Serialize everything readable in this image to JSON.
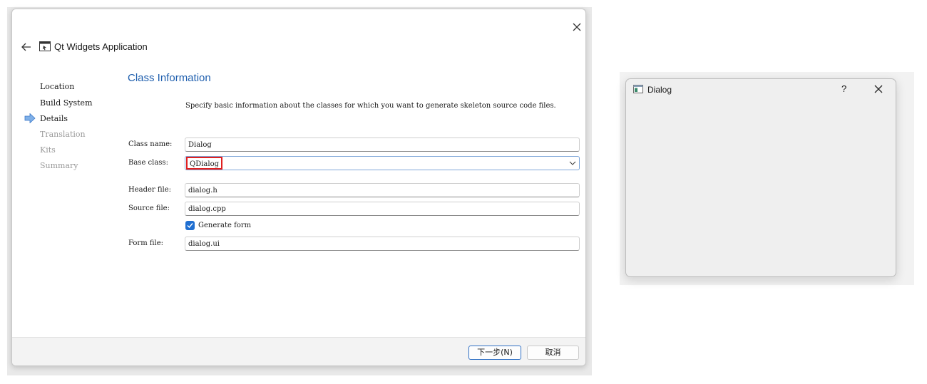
{
  "wizard": {
    "title": "Qt Widgets Application",
    "steps": [
      {
        "label": "Location",
        "state": "done"
      },
      {
        "label": "Build System",
        "state": "done"
      },
      {
        "label": "Details",
        "state": "current"
      },
      {
        "label": "Translation",
        "state": "pending"
      },
      {
        "label": "Kits",
        "state": "pending"
      },
      {
        "label": "Summary",
        "state": "pending"
      }
    ],
    "section_title": "Class Information",
    "description": "Specify basic information about the classes for which you want to generate skeleton source code files.",
    "fields": {
      "class_name": {
        "label": "Class name:",
        "value": "Dialog"
      },
      "base_class": {
        "label": "Base class:",
        "value": "QDialog"
      },
      "header_file": {
        "label": "Header file:",
        "value": "dialog.h"
      },
      "source_file": {
        "label": "Source file:",
        "value": "dialog.cpp"
      },
      "generate_form": {
        "label": "Generate form",
        "checked": true
      },
      "form_file": {
        "label": "Form file:",
        "value": "dialog.ui"
      }
    },
    "buttons": {
      "next": "下一步(N)",
      "cancel": "取消"
    },
    "icons": {
      "close": "close-icon",
      "back": "back-arrow-icon",
      "app": "qt-widgets-app-icon",
      "current_step": "current-step-arrow-icon",
      "dropdown": "chevron-down-icon",
      "check": "checkmark-icon"
    },
    "colors": {
      "accent": "#1f6fd1",
      "section_title": "#1f5fae",
      "highlight_box": "#e02020"
    }
  },
  "dialog_preview": {
    "title": "Dialog",
    "help_label": "?",
    "icons": {
      "window": "window-icon",
      "close": "close-icon"
    }
  }
}
